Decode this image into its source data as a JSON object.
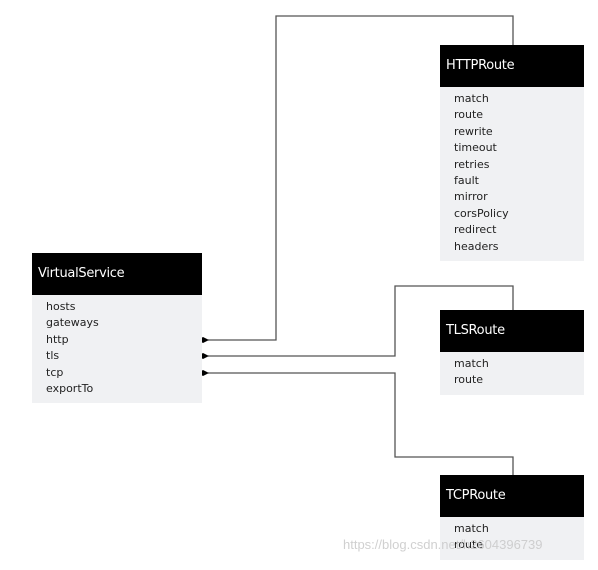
{
  "virtual_service": {
    "title": "VirtualService",
    "fields": [
      "hosts",
      "gateways",
      "http",
      "tls",
      "tcp",
      "exportTo"
    ]
  },
  "http_route": {
    "title": "HTTPRoute",
    "fields": [
      "match",
      "route",
      "rewrite",
      "timeout",
      "retries",
      "fault",
      "mirror",
      "corsPolicy",
      "redirect",
      "headers"
    ]
  },
  "tls_route": {
    "title": "TLSRoute",
    "fields": [
      "match",
      "route"
    ]
  },
  "tcp_route": {
    "title": "TCPRoute",
    "fields": [
      "match",
      "route"
    ]
  },
  "connections": [
    {
      "from": "VirtualService.http",
      "to": "HTTPRoute",
      "type": "composition"
    },
    {
      "from": "VirtualService.tls",
      "to": "TLSRoute",
      "type": "composition"
    },
    {
      "from": "VirtualService.tcp",
      "to": "TCPRoute",
      "type": "composition"
    }
  ],
  "watermark": "https://blog.csdn.net/h2604396739"
}
